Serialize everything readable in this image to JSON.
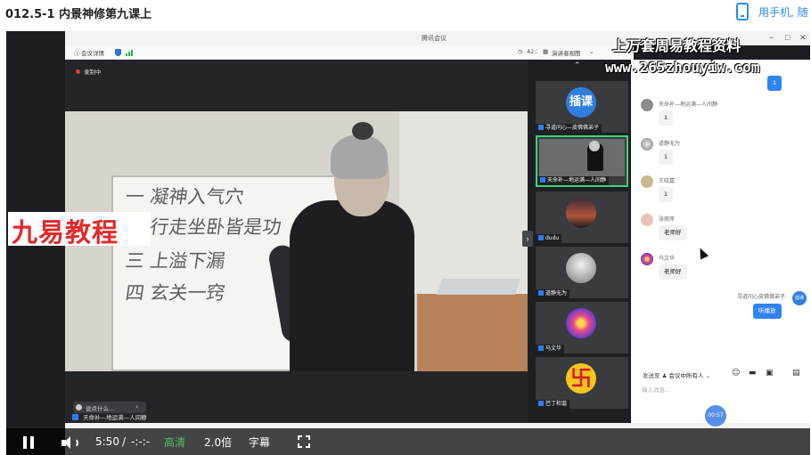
{
  "page": {
    "course_title": "012.5-1 内景神修第九课上",
    "mobile_link": "用手机, 随"
  },
  "meeting": {
    "app_title": "腾讯会议",
    "meeting_details": "会议详情",
    "time_display": "42:35",
    "layout_view": "演讲者视图",
    "recording_label": "录制中",
    "chat_input_hint": "说点什么...",
    "speaker_name": "天命补—地运满—人间静",
    "colors": {
      "accent": "#2f83f2",
      "active_tile": "#3bd47a",
      "record": "#e23b3b"
    }
  },
  "watermarks": {
    "top_line": "上万套周易教程资料",
    "url": "www.265zhouyiw.com",
    "left_brand": "九易教程"
  },
  "whiteboard": {
    "lines": [
      "一 凝神入气穴",
      "二 行走坐卧皆是功",
      "三 上溢下漏",
      "四 玄关一窍"
    ]
  },
  "participants": [
    {
      "name": "寻道问心—皮佛佛弟子",
      "avatar_text": "插课",
      "avatar_kind": "chake-icon"
    },
    {
      "name": "天命补—地运满—人间静",
      "avatar_kind": "camera-video",
      "active": true
    },
    {
      "name": "dudu",
      "avatar_kind": "sunset-avatar"
    },
    {
      "name": "道静无为",
      "avatar_kind": "fog-avatar"
    },
    {
      "name": "马文华",
      "avatar_kind": "flower-avatar"
    },
    {
      "name": "巴丁和谐",
      "avatar_text": "卐",
      "avatar_kind": "swastika-avatar"
    }
  ],
  "chat": {
    "messages": [
      {
        "sender": "天命补—地运满—人间静",
        "text": "1"
      },
      {
        "sender": "道静无为",
        "text": "1"
      },
      {
        "sender": "王晓嘉",
        "text": "1"
      },
      {
        "sender": "张丽萍",
        "text": "老师好"
      },
      {
        "sender": "马文华",
        "text": "老师好"
      }
    ],
    "own_top_text": "1",
    "own_name": "寻道问心皮佛佛弟子",
    "own_avatar": "插课",
    "own_text": "听播放",
    "send_to_label": "发送至",
    "send_to_target": "会议中所有人",
    "input_placeholder": "输入消息...",
    "timer": "00:57"
  },
  "player": {
    "time_current": "5:50",
    "time_separator": "/",
    "time_total": "-:-:-",
    "quality": "高清",
    "speed": "2.0倍",
    "subtitles": "字幕"
  }
}
